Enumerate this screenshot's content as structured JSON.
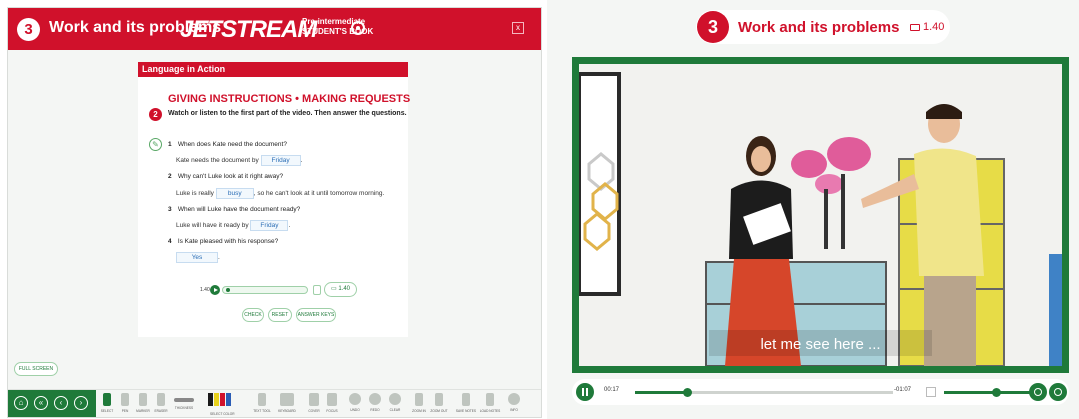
{
  "book": {
    "unit_number": "3",
    "unit_title": "Work and its problems",
    "brand": "JETSTREAM",
    "level_line1": "Pre-intermediate",
    "level_line2": "STUDENT'S BOOK",
    "close": "x"
  },
  "page": {
    "section": "Language in Action",
    "heading": "GIVING INSTRUCTIONS • MAKING REQUESTS",
    "exercise_number": "2",
    "instruction": "Watch or listen to the first part of the video. Then answer the questions.",
    "questions": [
      {
        "n": "1",
        "q": "When does Kate need the document?",
        "before": "Kate needs the document by",
        "answer": "Friday",
        "after": "."
      },
      {
        "n": "2",
        "q": "Why can't Luke look at it right away?",
        "before": "Luke is really",
        "answer": "busy",
        "after": ", so he can't look at it until tomorrow morning."
      },
      {
        "n": "3",
        "q": "When will Luke have the document ready?",
        "before": "Luke will have it ready by",
        "answer": "Friday",
        "after": "."
      },
      {
        "n": "4",
        "q": "Is Kate pleased with his response?",
        "before": "",
        "answer": "Yes",
        "after": "."
      }
    ],
    "audio_time": "1.40",
    "video_duration": "1.40",
    "buttons": {
      "check": "CHECK",
      "reset": "RESET",
      "answer_keys": "ANSWER KEYS"
    }
  },
  "sidebar": {
    "full_screen": "FULL SCREEN"
  },
  "toolbar": {
    "tools": [
      "SELECT",
      "PEN",
      "MARKER",
      "ERASER",
      "THICKNESS",
      "SELECT COLOR",
      "TEXT TOOL",
      "KEYBOARD",
      "COVER",
      "FOCUS",
      "UNDO",
      "REDO",
      "CLEAR",
      "ZOOM IN",
      "ZOOM OUT",
      "SAVE NOTES",
      "LOAD NOTES",
      "INFO"
    ],
    "colors": [
      "#1a1a1a",
      "#e8d21c",
      "#d0112b",
      "#2a5db5"
    ]
  },
  "video": {
    "unit_number": "3",
    "unit_title": "Work and its problems",
    "duration": "1.40",
    "subtitle": "let me see here ...",
    "elapsed": "00:17",
    "remaining": "-01:07",
    "progress": 0.2,
    "volume": 0.6
  },
  "colors": {
    "brand_red": "#d0112b",
    "accent_green": "#1f7a3a"
  }
}
